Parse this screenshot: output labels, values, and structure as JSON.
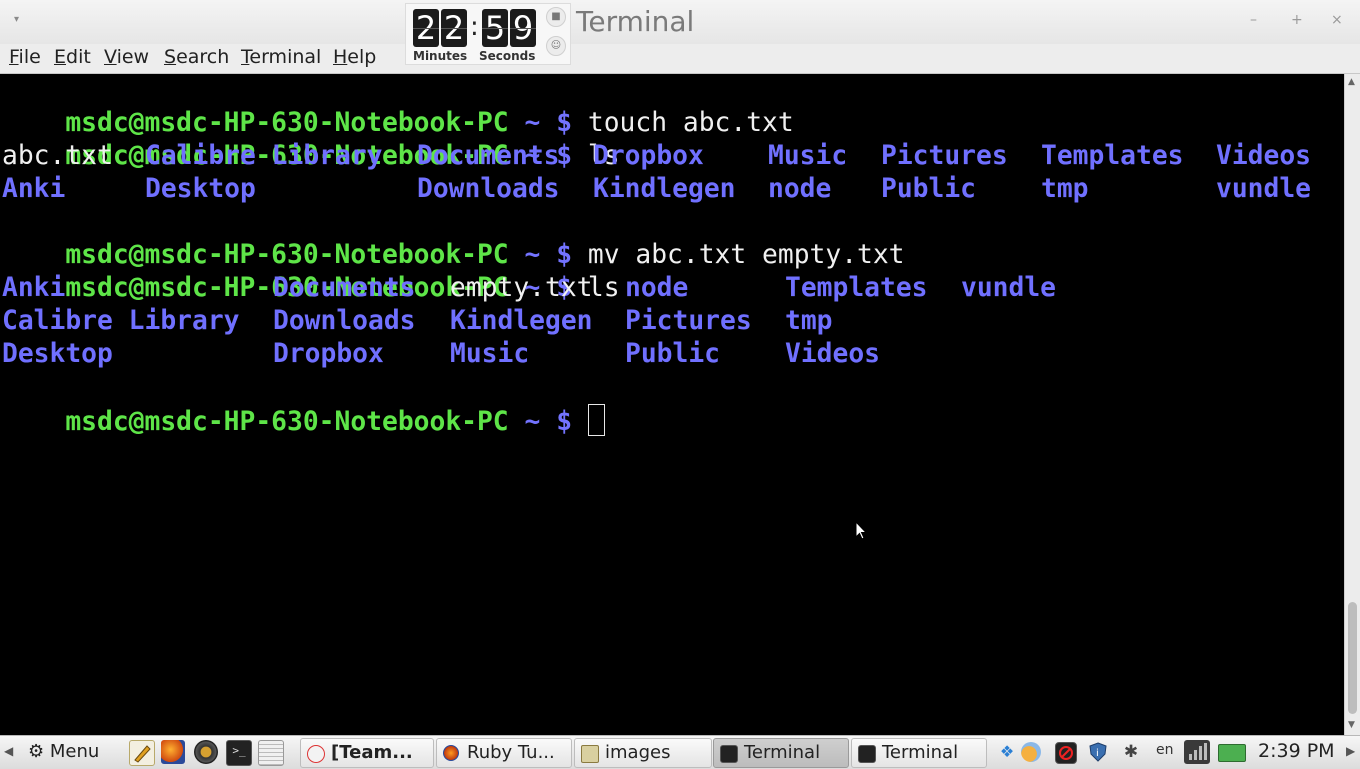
{
  "window": {
    "title": "Terminal",
    "minimize": "–",
    "maximize": "+",
    "close": "×"
  },
  "countdown": {
    "minutes_digits": [
      "2",
      "2"
    ],
    "separator": ":",
    "seconds_digits": [
      "5",
      "9"
    ],
    "minutes_label": "Minutes",
    "seconds_label": "Seconds"
  },
  "menubar": {
    "items": [
      "File",
      "Edit",
      "View",
      "Search",
      "Terminal",
      "Help"
    ]
  },
  "terminal": {
    "prompt": "msdc@msdc-HP-630-Notebook-PC",
    "tilde": "~",
    "dollar": "$",
    "commands": [
      "touch abc.txt",
      "ls",
      "mv abc.txt empty.txt",
      "ls"
    ],
    "ls1": [
      [
        "abc.txt",
        "Calibre Library",
        "Documents",
        "Dropbox",
        "Music",
        "Pictures",
        "Templates",
        "Videos"
      ],
      [
        "Anki",
        "Desktop",
        "Downloads",
        "Kindlegen",
        "node",
        "Public",
        "tmp",
        "vundle"
      ]
    ],
    "ls2": [
      [
        "Anki",
        "Documents",
        "empty.txt",
        "node",
        "Templates",
        "vundle"
      ],
      [
        "Calibre Library",
        "Downloads",
        "Kindlegen",
        "Pictures",
        "tmp"
      ],
      [
        "Desktop",
        "Dropbox",
        "Music",
        "Public",
        "Videos"
      ]
    ]
  },
  "taskbar": {
    "menu_label": "Menu",
    "tasks": [
      "[Team...",
      "Ruby Tu...",
      "images",
      "Terminal",
      "Terminal"
    ],
    "keyboard_layout": "en",
    "clock": "2:39 PM"
  },
  "colors": {
    "prompt": "#5ee548",
    "directory": "#7070ff",
    "text": "#f0f0f0"
  },
  "icons": {
    "launchers": [
      "text-editor-icon",
      "firefox-icon",
      "speaker-icon",
      "terminal-icon",
      "notes-icon"
    ],
    "tray": [
      "dropbox-icon",
      "weather-icon",
      "blocker-icon",
      "shield-icon",
      "bluetooth-icon",
      "network-icon",
      "battery-icon"
    ]
  }
}
